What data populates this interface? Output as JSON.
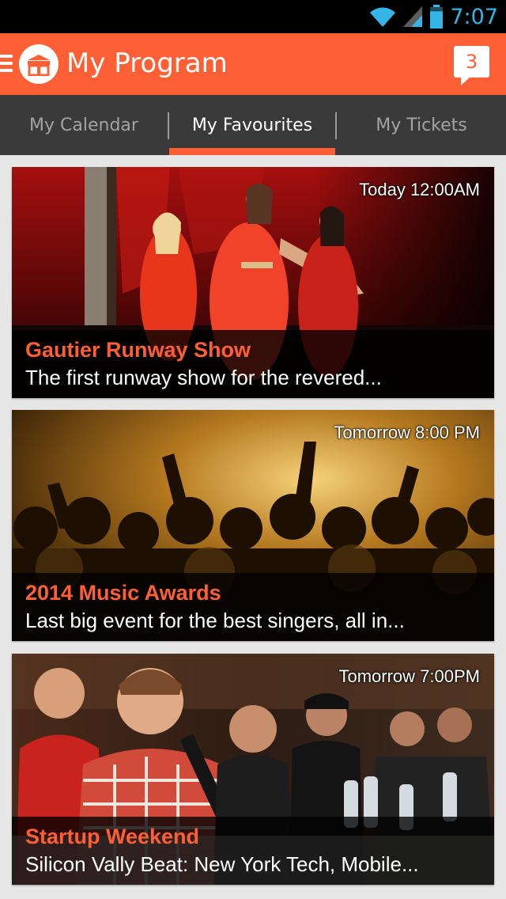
{
  "status_bar": {
    "time": "7:07",
    "battery_level": 0.8
  },
  "app_bar": {
    "title": "My Program",
    "notification_count": "3"
  },
  "tabs": [
    {
      "label": "My Calendar",
      "active": false
    },
    {
      "label": "My Favourites",
      "active": true
    },
    {
      "label": "My Tickets",
      "active": false
    }
  ],
  "events": [
    {
      "time": "Today 12:00AM",
      "title": "Gautier Runway Show",
      "description": "The first runway show for the revered..."
    },
    {
      "time": "Tomorrow 8:00 PM",
      "title": "2014 Music Awards",
      "description": "Last big event for the best singers, all in..."
    },
    {
      "time": "Tomorrow 7:00PM",
      "title": "Startup Weekend",
      "description": "Silicon Vally Beat: New York Tech, Mobile..."
    }
  ],
  "colors": {
    "accent": "#ff5f35",
    "tab_bar": "#3a3a3a",
    "status_time": "#33b5e5",
    "background": "#e6e6e6"
  },
  "icons": {
    "wifi": "wifi-icon",
    "signal": "signal-icon",
    "battery": "battery-icon",
    "menu": "hamburger-icon",
    "logo": "gift-box-icon",
    "notifications": "chat-bubble-icon"
  }
}
